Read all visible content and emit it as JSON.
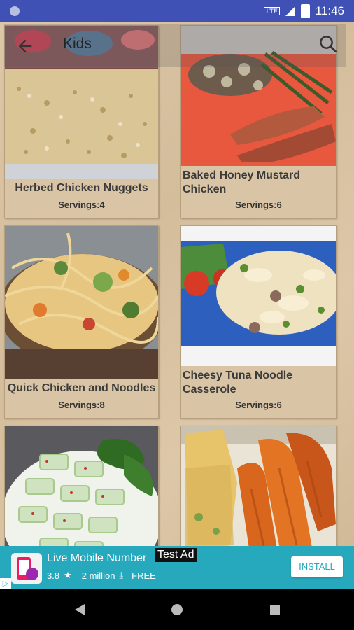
{
  "statusbar": {
    "time": "11:46",
    "network": "LTE"
  },
  "toolbar": {
    "title": "Kids"
  },
  "recipes": [
    {
      "title": "Herbed Chicken Nuggets",
      "servings": "Servings:4"
    },
    {
      "title": "Baked Honey Mustard Chicken",
      "servings": "Servings:6"
    },
    {
      "title": "Quick Chicken and Noodles",
      "servings": "Servings:8"
    },
    {
      "title": "Cheesy Tuna Noodle Casserole",
      "servings": "Servings:6"
    },
    {
      "title": "",
      "servings": ""
    },
    {
      "title": "",
      "servings": ""
    }
  ],
  "ad": {
    "title": "Live Mobile Number",
    "tag": "Test Ad",
    "rating": "3.8",
    "downloads": "2 million",
    "price": "FREE",
    "install": "INSTALL"
  },
  "icons": {
    "back": "back-arrow-icon",
    "search": "search-icon",
    "star": "star-icon",
    "download": "download-icon"
  }
}
